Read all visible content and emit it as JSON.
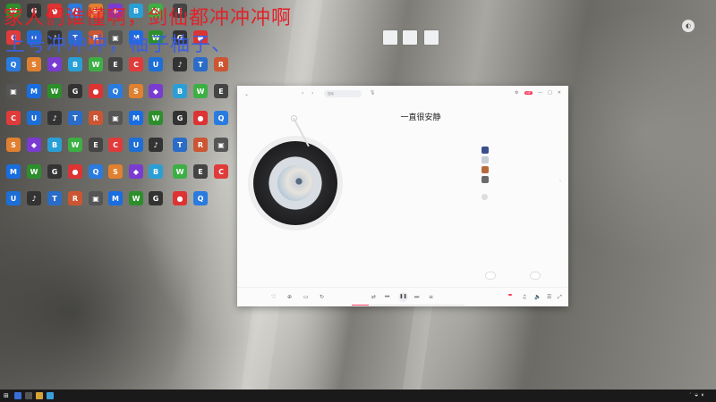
{
  "overlay": {
    "line1": "家人们谁懂啊，剑仙都冲冲冲啊",
    "line2": "上号冲冲冲，柚子柚子、"
  },
  "desktop": {
    "icons": [
      {
        "label": "",
        "color": "#2c8f2c",
        "glyph": "W"
      },
      {
        "label": "",
        "color": "#333",
        "glyph": "G"
      },
      {
        "label": "",
        "color": "#d33",
        "glyph": "●"
      },
      {
        "label": "",
        "color": "#2a7be0",
        "glyph": "Q"
      },
      {
        "label": "",
        "color": "#e08030",
        "glyph": "S"
      },
      {
        "label": "",
        "color": "#7a3bd1",
        "glyph": "◆"
      },
      {
        "label": "",
        "color": "#2a9fd6",
        "glyph": "B"
      },
      {
        "label": "",
        "color": "#3cb043",
        "glyph": "W"
      },
      {
        "label": "",
        "color": "#444",
        "glyph": "E"
      },
      {
        "label": "",
        "color": "#e03b3b",
        "glyph": "C"
      },
      {
        "label": "",
        "color": "#1d6fd6",
        "glyph": "U"
      },
      {
        "label": "",
        "color": "#333",
        "glyph": "♪"
      },
      {
        "label": "",
        "color": "#2a6cc7",
        "glyph": "T"
      },
      {
        "label": "",
        "color": "#c53",
        "glyph": "R"
      },
      {
        "label": "",
        "color": "#555",
        "glyph": "▣"
      },
      {
        "label": "",
        "color": "#1a6de0",
        "glyph": "M"
      }
    ],
    "files": [
      {
        "label": ""
      },
      {
        "label": ""
      },
      {
        "label": ""
      }
    ]
  },
  "player": {
    "search_placeholder": "搜索",
    "titlebar_buttons": [
      "‹",
      "›"
    ],
    "right_controls": [
      "VIP",
      "—",
      "□",
      "✕"
    ],
    "song_title": "一直很安静",
    "song_subtitle": "",
    "lyrics": [
      "",
      "",
      "",
      "",
      "",
      "",
      "",
      "",
      "",
      "",
      ""
    ],
    "active_lyric_index": 6,
    "side_heading": "",
    "side_subheading": "",
    "side_items": [
      "",
      "",
      "",
      ""
    ],
    "side_heading2": "",
    "side_user": "",
    "comments_label": "",
    "pill_left": "",
    "pill_right": "",
    "time_elapsed": "",
    "time_total": "",
    "quality": "",
    "progress": 0.15
  },
  "taskbar": {
    "start_glyph": "⊞",
    "tray_time": "",
    "tray_date": ""
  },
  "colors": {
    "accent": "#ff3a5a",
    "overlay_red": "#e0222a",
    "overlay_blue": "#3b5fe0"
  }
}
